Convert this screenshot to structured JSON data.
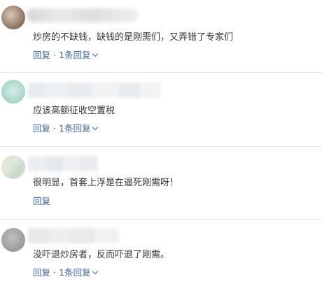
{
  "colors": {
    "link": "#406599",
    "text": "#333333",
    "divider": "#e8e8e8"
  },
  "comments": [
    {
      "text": "炒房的不缺钱，缺钱的是刚需们，又弄错了专家们",
      "reply_label": "回复",
      "separator": "·",
      "replies_label": "1条回复",
      "expand_icon": "chevron-down-icon"
    },
    {
      "text": "应该高额征收空置税",
      "reply_label": "回复",
      "separator": "·",
      "replies_label": "1条回复",
      "expand_icon": "chevron-down-icon"
    },
    {
      "text": "很明显，首套上浮是在逼死刚需呀！",
      "reply_label": "回复"
    },
    {
      "text": "没吓退炒房者，反而吓退了刚需。",
      "reply_label": "回复",
      "separator": "·",
      "replies_label": "1条回复",
      "expand_icon": "chevron-down-icon"
    }
  ]
}
